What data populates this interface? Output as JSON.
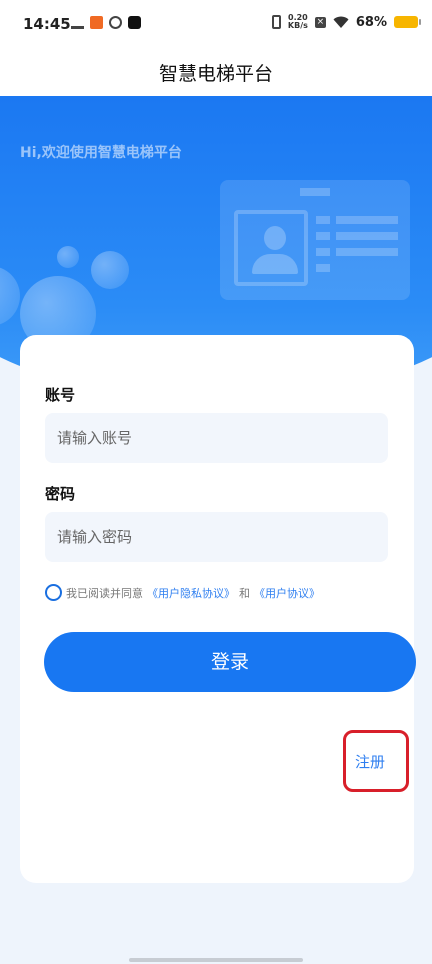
{
  "status_bar": {
    "time": "14:45",
    "net_speed_value": "0.20",
    "net_speed_unit": "KB/s",
    "battery_percent": "68%",
    "battery_color": "#f7b500"
  },
  "header": {
    "title": "智慧电梯平台"
  },
  "hero": {
    "welcome": "Hi,欢迎使用智慧电梯平台"
  },
  "form": {
    "account_label": "账号",
    "account_placeholder": "请输入账号",
    "password_label": "密码",
    "password_placeholder": "请输入密码",
    "agreement_prefix": "我已阅读并同意",
    "privacy_link": "《用户隐私协议》",
    "agreement_and": "和",
    "user_agreement_link": "《用户协议》",
    "login_label": "登录",
    "register_label": "注册"
  },
  "colors": {
    "primary": "#1877f2",
    "link": "#2f7ff0",
    "highlight_border": "#d81f2a"
  }
}
